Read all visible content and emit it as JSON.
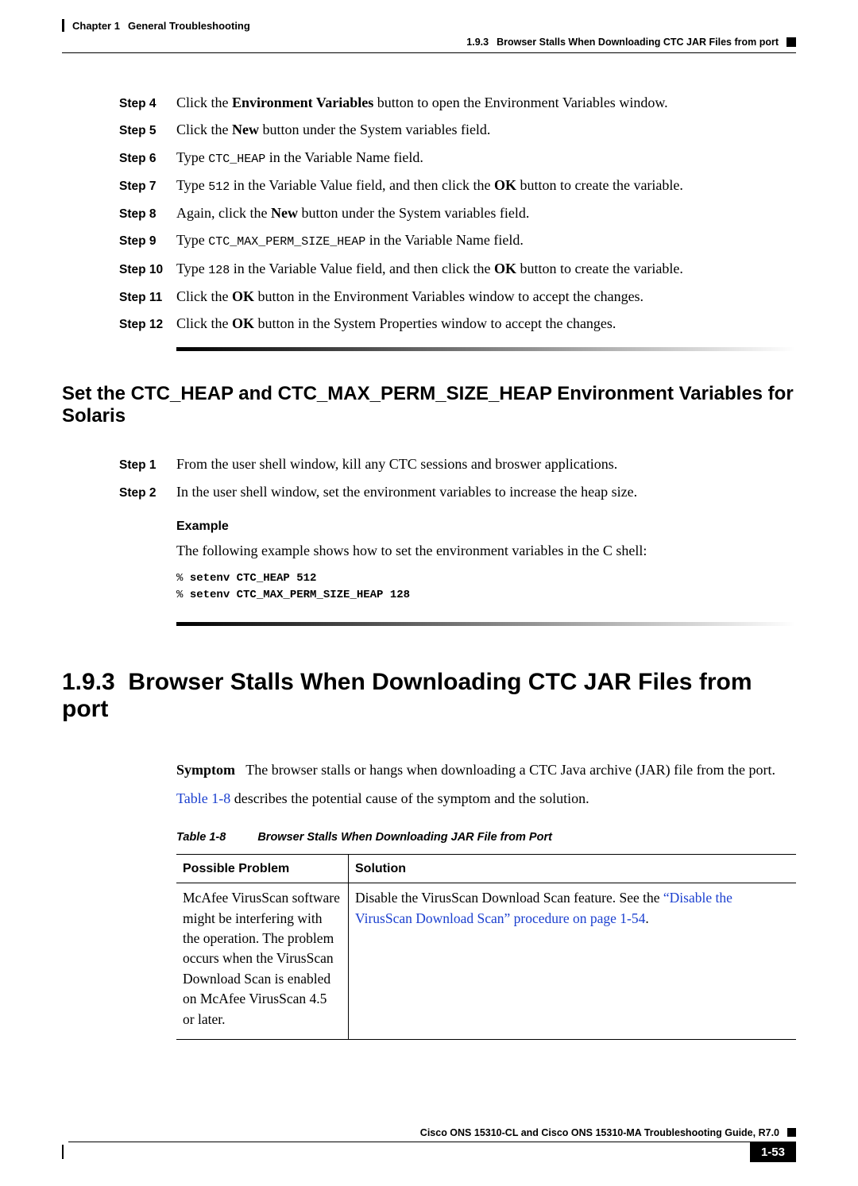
{
  "header": {
    "chapter_label": "Chapter 1",
    "chapter_title": "General Troubleshooting",
    "section_num": "1.9.3",
    "section_title": "Browser Stalls When Downloading CTC JAR Files from port"
  },
  "steps_a": [
    {
      "label": "Step 4",
      "html": "Click the <b>Environment Variables</b> button to open the Environment Variables window."
    },
    {
      "label": "Step 5",
      "html": "Click the <b>New</b> button under the System variables field."
    },
    {
      "label": "Step 6",
      "html": "Type <span class='mono'>CTC_HEAP</span> in the Variable Name field."
    },
    {
      "label": "Step 7",
      "html": "Type <span class='mono'>512</span> in the Variable Value field, and then click the <b>OK</b> button to create the variable."
    },
    {
      "label": "Step 8",
      "html": "Again, click the <b>New</b> button under the System variables field."
    },
    {
      "label": "Step 9",
      "html": "Type <span class='mono'>CTC_MAX_PERM_SIZE_HEAP</span> in the Variable Name field."
    },
    {
      "label": "Step 10",
      "html": "Type <span class='mono'>128</span>  in the Variable Value field, and then click the <b>OK</b> button to create the variable."
    },
    {
      "label": "Step 11",
      "html": "Click the <b>OK</b> button in the Environment Variables window to accept the changes."
    },
    {
      "label": "Step 12",
      "html": "Click the <b>OK</b> button in the System Properties window to accept the changes."
    }
  ],
  "h2": "Set the CTC_HEAP and CTC_MAX_PERM_SIZE_HEAP Environment Variables for Solaris",
  "steps_b": [
    {
      "label": "Step 1",
      "html": "From the user shell window, kill any CTC sessions and broswer applications."
    },
    {
      "label": "Step 2",
      "html": "In the user shell window, set the environment variables to increase the heap size."
    }
  ],
  "example": {
    "label": "Example",
    "intro": "The following example shows how to set the environment variables in the C shell:",
    "code_line1": "setenv CTC_HEAP 512",
    "code_line2": "setenv CTC_MAX_PERM_SIZE_HEAP 128",
    "prompt": "% "
  },
  "h1_num": "1.9.3",
  "h1_title": "Browser Stalls When Downloading CTC JAR Files from port",
  "symptom_label": "Symptom",
  "symptom_text": "The browser stalls or hangs when downloading a CTC Java archive (JAR) file from the port.",
  "table_ref": "Table 1-8",
  "table_ref_sentence": " describes the potential cause of the symptom and the solution.",
  "table_caption_num": "Table 1-8",
  "table_caption_title": "Browser Stalls When Downloading JAR File from Port",
  "table": {
    "col1": "Possible Problem",
    "col2": "Solution",
    "row1_problem": "McAfee VirusScan software might be interfering with the operation. The problem occurs when the VirusScan Download Scan is enabled on McAfee VirusScan 4.5 or later.",
    "row1_solution_pre": "Disable the VirusScan Download Scan feature. See the ",
    "row1_solution_link": "“Disable the VirusScan Download Scan” procedure on page 1-54",
    "row1_solution_post": "."
  },
  "footer": {
    "doc_title": "Cisco ONS 15310-CL and Cisco ONS 15310-MA Troubleshooting Guide, R7.0",
    "page": "1-53"
  }
}
